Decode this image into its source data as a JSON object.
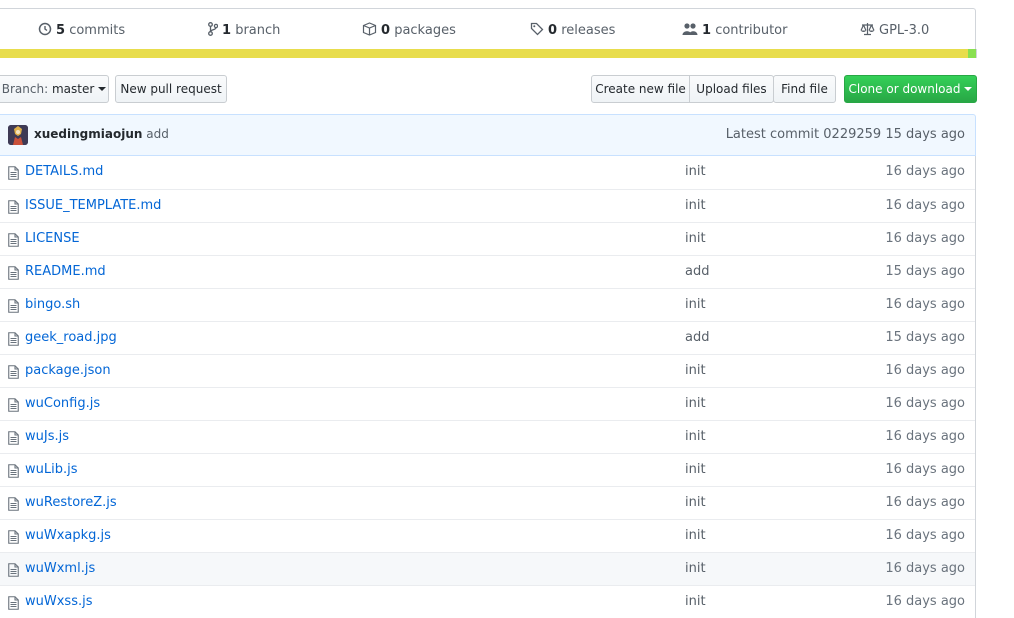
{
  "summary": {
    "commits": {
      "count": "5",
      "label": "commits",
      "icon": "history-icon"
    },
    "branches": {
      "count": "1",
      "label": "branch",
      "icon": "branch-icon"
    },
    "packages": {
      "count": "0",
      "label": "packages",
      "icon": "package-icon"
    },
    "releases": {
      "count": "0",
      "label": "releases",
      "icon": "tag-icon"
    },
    "contributors": {
      "count": "1",
      "label": "contributor",
      "icon": "people-icon"
    },
    "license": {
      "label": "GPL-3.0",
      "icon": "law-icon"
    }
  },
  "language_colors": {
    "primary": "#e8dd4d",
    "secondary": "#89e051"
  },
  "toolbar": {
    "branch_prefix": "Branch:",
    "branch_name": "master",
    "new_pull_request": "New pull request",
    "create_new_file": "Create new file",
    "upload_files": "Upload files",
    "find_file": "Find file",
    "clone_or_download": "Clone or download"
  },
  "latest_commit": {
    "author": "xuedingmiaojun",
    "message": "add",
    "label": "Latest commit",
    "sha": "0229259",
    "age": "15 days ago"
  },
  "files": [
    {
      "name": "DETAILS.md",
      "message": "init",
      "age": "16 days ago"
    },
    {
      "name": "ISSUE_TEMPLATE.md",
      "message": "init",
      "age": "16 days ago"
    },
    {
      "name": "LICENSE",
      "message": "init",
      "age": "16 days ago"
    },
    {
      "name": "README.md",
      "message": "add",
      "age": "15 days ago"
    },
    {
      "name": "bingo.sh",
      "message": "init",
      "age": "16 days ago"
    },
    {
      "name": "geek_road.jpg",
      "message": "add",
      "age": "15 days ago"
    },
    {
      "name": "package.json",
      "message": "init",
      "age": "16 days ago"
    },
    {
      "name": "wuConfig.js",
      "message": "init",
      "age": "16 days ago"
    },
    {
      "name": "wuJs.js",
      "message": "init",
      "age": "16 days ago"
    },
    {
      "name": "wuLib.js",
      "message": "init",
      "age": "16 days ago"
    },
    {
      "name": "wuRestoreZ.js",
      "message": "init",
      "age": "16 days ago"
    },
    {
      "name": "wuWxapkg.js",
      "message": "init",
      "age": "16 days ago"
    },
    {
      "name": "wuWxml.js",
      "message": "init",
      "age": "16 days ago"
    },
    {
      "name": "wuWxss.js",
      "message": "init",
      "age": "16 days ago"
    }
  ]
}
